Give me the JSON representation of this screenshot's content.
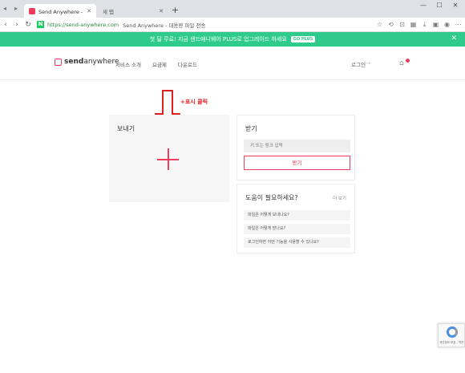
{
  "browser": {
    "tabs": [
      {
        "title": "Send Anywhere - 대용량",
        "active": true
      },
      {
        "title": "새 탭",
        "active": false
      }
    ],
    "new_tab": "+",
    "url": "https://send-anywhere.com",
    "page_title": "Send Anywhere - 대용량 파일 전송",
    "win_min": "—",
    "win_max": "☐",
    "win_close": "✕"
  },
  "promo": {
    "text": "첫 달 무료! 지금 샌드애니웨어 PLUS로 업그레이드 하세요",
    "badge": "GO PLUS",
    "close": "✕",
    "color": "#2fcb8c"
  },
  "header": {
    "logo_bold": "send",
    "logo_rest": "anywhere",
    "nav": [
      "서비스 소개",
      "요금제",
      "다운로드"
    ],
    "login": "로그인",
    "accent": "#ef3b5d"
  },
  "annotation": {
    "text": "+표시 클릭"
  },
  "send": {
    "title": "보내기"
  },
  "receive": {
    "title": "받기",
    "placeholder": "키 또는 링크 입력",
    "button": "받기"
  },
  "help": {
    "title": "도움이 필요하세요?",
    "more": "더 보기",
    "items": [
      "파일은 어떻게 보내나요?",
      "파일은 어떻게 받나요?",
      "로그인하면 어떤 기능을 사용할 수 있나요?"
    ]
  },
  "recaptcha": {
    "text": "개인정보 보호 - 약관"
  }
}
